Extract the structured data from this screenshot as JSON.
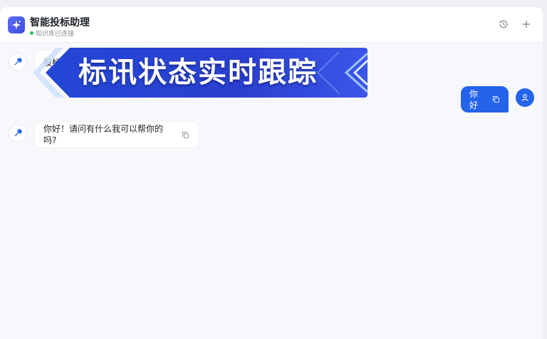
{
  "app": {
    "title": "智能投标助理",
    "status_text": "知识库已连接",
    "status_color": "#22c55e",
    "accent_color": "#2563eb"
  },
  "header": {
    "history_icon": "history-icon",
    "new_chat_icon": "plus-icon"
  },
  "overlay_banner": {
    "text": "标讯状态实时跟踪"
  },
  "messages": [
    {
      "role": "assistant",
      "text": "投标",
      "avatar_icon": "hammer-icon"
    },
    {
      "role": "user",
      "text": "你好",
      "avatar_icon": "user-icon"
    },
    {
      "role": "assistant",
      "text": "你好！请问有什么我可以帮你的吗?",
      "avatar_icon": "hammer-icon"
    }
  ]
}
